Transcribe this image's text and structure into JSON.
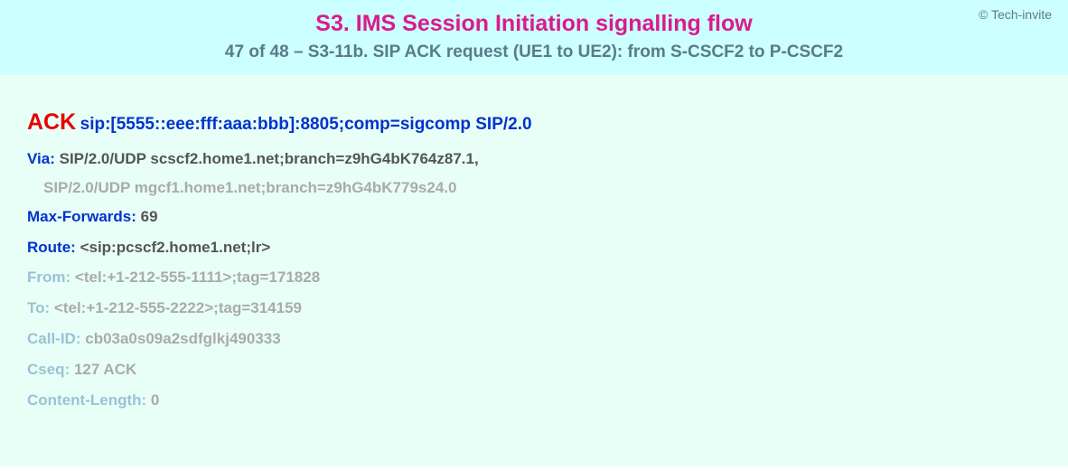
{
  "copyright": "© Tech-invite",
  "title": "S3. IMS Session Initiation signalling flow",
  "subtitle": "47 of 48 – S3-11b. SIP ACK request (UE1 to UE2): from S-CSCF2 to P-CSCF2",
  "request": {
    "method": "ACK",
    "uri": "sip:[5555::eee:fff:aaa:bbb]:8805;comp=sigcomp SIP/2.0"
  },
  "headers": {
    "via": {
      "name": "Via:",
      "line1": "SIP/2.0/UDP scscf2.home1.net;branch=z9hG4bK764z87.1,",
      "line2": "SIP/2.0/UDP mgcf1.home1.net;branch=z9hG4bK779s24.0"
    },
    "maxForwards": {
      "name": "Max-Forwards:",
      "value": "69"
    },
    "route": {
      "name": "Route:",
      "value": "<sip:pcscf2.home1.net;lr>"
    },
    "from": {
      "name": "From:",
      "value": "<tel:+1-212-555-1111>;tag=171828"
    },
    "to": {
      "name": "To:",
      "value": "<tel:+1-212-555-2222>;tag=314159"
    },
    "callId": {
      "name": "Call-ID:",
      "value": "cb03a0s09a2sdfglkj490333"
    },
    "cseq": {
      "name": "Cseq:",
      "value": "127 ACK"
    },
    "contentLength": {
      "name": "Content-Length:",
      "value": "0"
    }
  }
}
